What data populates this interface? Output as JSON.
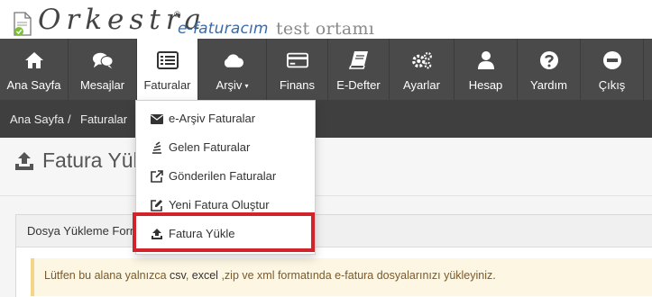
{
  "brand": {
    "name": "Orkestra",
    "registered": "®",
    "product": "e-faturacım",
    "environment": "test ortamı"
  },
  "nav": {
    "items": [
      {
        "label": "Ana Sayfa",
        "icon": "home-icon"
      },
      {
        "label": "Mesajlar",
        "icon": "chat-icon"
      },
      {
        "label": "Faturalar",
        "icon": "invoice-list-icon",
        "active": true
      },
      {
        "label": "Arşiv",
        "icon": "cloud-icon",
        "caret": "▾"
      },
      {
        "label": "Finans",
        "icon": "credit-card-icon"
      },
      {
        "label": "E-Defter",
        "icon": "book-icon"
      },
      {
        "label": "Ayarlar",
        "icon": "cogs-icon"
      },
      {
        "label": "Hesap",
        "icon": "user-icon"
      },
      {
        "label": "Yardım",
        "icon": "question-icon"
      },
      {
        "label": "Çıkış",
        "icon": "minus-circle-icon"
      }
    ]
  },
  "breadcrumb": {
    "items": [
      "Ana Sayfa",
      "Faturalar"
    ],
    "separator": "/"
  },
  "page": {
    "title": "Fatura Yükle"
  },
  "panel": {
    "title": "Dosya Yükleme Formu",
    "notice_prefix": "Lütfen bu alana yalnızca ",
    "notice_csv": "csv",
    "notice_mid": ", ",
    "notice_excel": "excel",
    "notice_suffix": " ,zip ve xml formatında e-fatura dosyalarınızı yükleyiniz."
  },
  "dropdown": {
    "items": [
      {
        "label": "e-Arşiv Faturalar",
        "icon": "envelope-icon"
      },
      {
        "label": "Gelen Faturalar",
        "icon": "stack-icon"
      },
      {
        "label": "Gönderilen Faturalar",
        "icon": "external-link-icon"
      },
      {
        "label": "Yeni Fatura Oluştur",
        "icon": "edit-icon"
      },
      {
        "label": "Fatura Yükle",
        "icon": "upload-icon",
        "highlighted": true
      }
    ]
  },
  "colors": {
    "nav_bg": "#4a4a4a",
    "breadcrumb_bg": "#3f3f3f",
    "highlight": "#d2232a",
    "brand_blue": "#3a6aa8",
    "notice_bg": "#fcf6e3"
  }
}
